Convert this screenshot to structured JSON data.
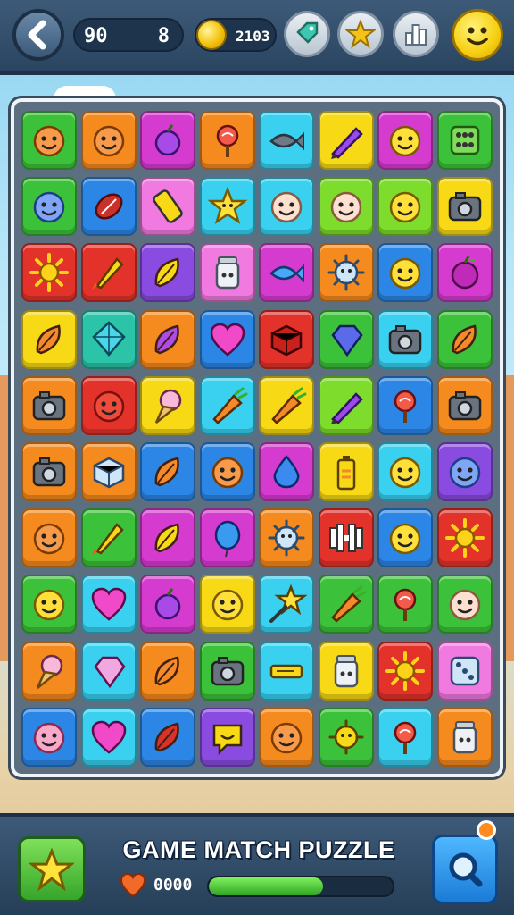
{
  "hud": {
    "stat_a": "90",
    "stat_b": "8",
    "coins": "2103",
    "buttons": [
      "back-button",
      "shop-button",
      "star-bonus-button",
      "leaderboard-button",
      "profile-smiley-button"
    ]
  },
  "game": {
    "title": "GAME MATCH PUZZLE",
    "lives": "0000",
    "progress": 0.62
  },
  "colors": {
    "green": "#3cc23a",
    "orange": "#f58a1e",
    "magenta": "#d63bd0",
    "cyan": "#3ad0ef",
    "yellow": "#f7d916",
    "red": "#e3322a",
    "blue": "#2b86e6",
    "purple": "#8a4be0",
    "lime": "#7ddc2c",
    "pink": "#f07ae0",
    "teal": "#2cc4a8"
  },
  "board": {
    "rows": [
      [
        [
          "green",
          "face-orange"
        ],
        [
          "orange",
          "face-orange"
        ],
        [
          "magenta",
          "grape"
        ],
        [
          "orange",
          "lollipop"
        ],
        [
          "cyan",
          "fish"
        ],
        [
          "yellow",
          "pen-purple"
        ],
        [
          "magenta",
          "face-yellow"
        ],
        [
          "green",
          "keypad"
        ]
      ],
      [
        [
          "green",
          "face-blue"
        ],
        [
          "blue",
          "football"
        ],
        [
          "pink",
          "phone"
        ],
        [
          "cyan",
          "star-face"
        ],
        [
          "cyan",
          "face-baby"
        ],
        [
          "lime",
          "face-baby"
        ],
        [
          "lime",
          "face-yellow"
        ],
        [
          "yellow",
          "camera"
        ]
      ],
      [
        [
          "red",
          "sun"
        ],
        [
          "red",
          "rocket"
        ],
        [
          "purple",
          "leaf-yellow"
        ],
        [
          "pink",
          "jar"
        ],
        [
          "magenta",
          "fish-blue"
        ],
        [
          "orange",
          "germ"
        ],
        [
          "blue",
          "face-yellow"
        ],
        [
          "magenta",
          "apple"
        ]
      ],
      [
        [
          "yellow",
          "leaf-orange"
        ],
        [
          "teal",
          "kite"
        ],
        [
          "orange",
          "leaf-purple"
        ],
        [
          "blue",
          "heart-pink"
        ],
        [
          "red",
          "box-red"
        ],
        [
          "green",
          "gem-blue"
        ],
        [
          "cyan",
          "camera"
        ],
        [
          "green",
          "leaf-orange"
        ]
      ],
      [
        [
          "orange",
          "camera"
        ],
        [
          "red",
          "face-red"
        ],
        [
          "yellow",
          "icecream"
        ],
        [
          "cyan",
          "carrot"
        ],
        [
          "yellow",
          "carrot"
        ],
        [
          "lime",
          "pen-purple"
        ],
        [
          "blue",
          "lollipop"
        ],
        [
          "orange",
          "camera"
        ]
      ],
      [
        [
          "orange",
          "camera"
        ],
        [
          "orange",
          "box-blue"
        ],
        [
          "blue",
          "leaf-orange"
        ],
        [
          "blue",
          "face-orange"
        ],
        [
          "magenta",
          "drop-blue"
        ],
        [
          "yellow",
          "battery"
        ],
        [
          "cyan",
          "face-yellow"
        ],
        [
          "purple",
          "face-blue"
        ]
      ],
      [
        [
          "orange",
          "face-orange"
        ],
        [
          "green",
          "rocket"
        ],
        [
          "magenta",
          "leaf-yellow"
        ],
        [
          "magenta",
          "balloon"
        ],
        [
          "orange",
          "germ"
        ],
        [
          "red",
          "barbell"
        ],
        [
          "blue",
          "face-yellow"
        ],
        [
          "red",
          "sun"
        ]
      ],
      [
        [
          "green",
          "face-yellow"
        ],
        [
          "cyan",
          "heart-pink"
        ],
        [
          "magenta",
          "grape"
        ],
        [
          "yellow",
          "face-yellow"
        ],
        [
          "cyan",
          "star-wand"
        ],
        [
          "green",
          "carrot"
        ],
        [
          "green",
          "lollipop"
        ],
        [
          "green",
          "face-baby"
        ]
      ],
      [
        [
          "orange",
          "icecream"
        ],
        [
          "cyan",
          "gem-pink"
        ],
        [
          "orange",
          "leaf-orange"
        ],
        [
          "green",
          "camera"
        ],
        [
          "cyan",
          "key"
        ],
        [
          "yellow",
          "jar"
        ],
        [
          "red",
          "sun"
        ],
        [
          "pink",
          "dice"
        ]
      ],
      [
        [
          "blue",
          "face-pink"
        ],
        [
          "cyan",
          "heart-pink"
        ],
        [
          "blue",
          "leaf-red"
        ],
        [
          "purple",
          "speech"
        ],
        [
          "orange",
          "face-orange"
        ],
        [
          "green",
          "germ-yellow"
        ],
        [
          "cyan",
          "lollipop"
        ],
        [
          "orange",
          "jar"
        ]
      ]
    ]
  }
}
